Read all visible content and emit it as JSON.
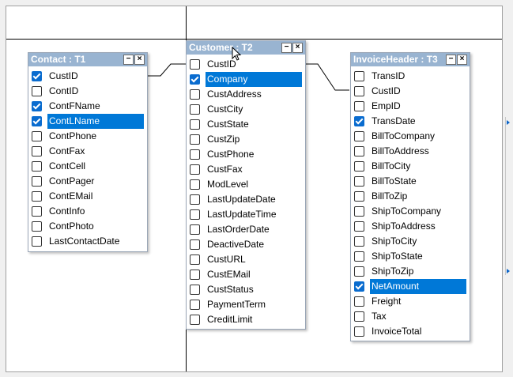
{
  "tables": {
    "contact": {
      "title": "Contact : T1",
      "fields": [
        {
          "label": "CustID",
          "checked": true,
          "selected": false
        },
        {
          "label": "ContID",
          "checked": false,
          "selected": false
        },
        {
          "label": "ContFName",
          "checked": true,
          "selected": false
        },
        {
          "label": "ContLName",
          "checked": true,
          "selected": true
        },
        {
          "label": "ContPhone",
          "checked": false,
          "selected": false
        },
        {
          "label": "ContFax",
          "checked": false,
          "selected": false
        },
        {
          "label": "ContCell",
          "checked": false,
          "selected": false
        },
        {
          "label": "ContPager",
          "checked": false,
          "selected": false
        },
        {
          "label": "ContEMail",
          "checked": false,
          "selected": false
        },
        {
          "label": "ContInfo",
          "checked": false,
          "selected": false
        },
        {
          "label": "ContPhoto",
          "checked": false,
          "selected": false
        },
        {
          "label": "LastContactDate",
          "checked": false,
          "selected": false
        }
      ]
    },
    "customer": {
      "title": "Customer : T2",
      "fields": [
        {
          "label": "CustID",
          "checked": false,
          "selected": false
        },
        {
          "label": "Company",
          "checked": true,
          "selected": true
        },
        {
          "label": "CustAddress",
          "checked": false,
          "selected": false
        },
        {
          "label": "CustCity",
          "checked": false,
          "selected": false
        },
        {
          "label": "CustState",
          "checked": false,
          "selected": false
        },
        {
          "label": "CustZip",
          "checked": false,
          "selected": false
        },
        {
          "label": "CustPhone",
          "checked": false,
          "selected": false
        },
        {
          "label": "CustFax",
          "checked": false,
          "selected": false
        },
        {
          "label": "ModLevel",
          "checked": false,
          "selected": false
        },
        {
          "label": "LastUpdateDate",
          "checked": false,
          "selected": false
        },
        {
          "label": "LastUpdateTime",
          "checked": false,
          "selected": false
        },
        {
          "label": "LastOrderDate",
          "checked": false,
          "selected": false
        },
        {
          "label": "DeactiveDate",
          "checked": false,
          "selected": false
        },
        {
          "label": "CustURL",
          "checked": false,
          "selected": false
        },
        {
          "label": "CustEMail",
          "checked": false,
          "selected": false
        },
        {
          "label": "CustStatus",
          "checked": false,
          "selected": false
        },
        {
          "label": "PaymentTerm",
          "checked": false,
          "selected": false
        },
        {
          "label": "CreditLimit",
          "checked": false,
          "selected": false
        }
      ]
    },
    "invoice": {
      "title": "InvoiceHeader : T3",
      "fields": [
        {
          "label": "TransID",
          "checked": false,
          "selected": false
        },
        {
          "label": "CustID",
          "checked": false,
          "selected": false
        },
        {
          "label": "EmpID",
          "checked": false,
          "selected": false
        },
        {
          "label": "TransDate",
          "checked": true,
          "selected": false
        },
        {
          "label": "BillToCompany",
          "checked": false,
          "selected": false
        },
        {
          "label": "BillToAddress",
          "checked": false,
          "selected": false
        },
        {
          "label": "BillToCity",
          "checked": false,
          "selected": false
        },
        {
          "label": "BillToState",
          "checked": false,
          "selected": false
        },
        {
          "label": "BillToZip",
          "checked": false,
          "selected": false
        },
        {
          "label": "ShipToCompany",
          "checked": false,
          "selected": false
        },
        {
          "label": "ShipToAddress",
          "checked": false,
          "selected": false
        },
        {
          "label": "ShipToCity",
          "checked": false,
          "selected": false
        },
        {
          "label": "ShipToState",
          "checked": false,
          "selected": false
        },
        {
          "label": "ShipToZip",
          "checked": false,
          "selected": false
        },
        {
          "label": "NetAmount",
          "checked": true,
          "selected": true
        },
        {
          "label": "Freight",
          "checked": false,
          "selected": false
        },
        {
          "label": "Tax",
          "checked": false,
          "selected": false
        },
        {
          "label": "InvoiceTotal",
          "checked": false,
          "selected": false
        }
      ]
    }
  },
  "window_buttons": {
    "minimize": "−",
    "close": "×"
  },
  "icons": {
    "minimize": "minimize-icon",
    "close": "close-icon",
    "cursor": "cursor-arrow-icon",
    "scroll_arrow": "arrow-right-icon"
  },
  "colors": {
    "titlebar": "#99b4d1",
    "selection": "#0078d7",
    "checkbox_on": "#0a6ccf"
  }
}
